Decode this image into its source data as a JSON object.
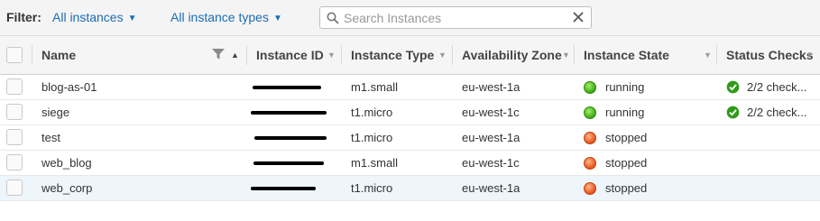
{
  "filter": {
    "label": "Filter:",
    "instances_dropdown": "All instances",
    "types_dropdown": "All instance types",
    "search_placeholder": "Search Instances"
  },
  "columns": {
    "name": "Name",
    "instance_id": "Instance ID",
    "instance_type": "Instance Type",
    "availability_zone": "Availability Zone",
    "instance_state": "Instance State",
    "status_checks": "Status Checks"
  },
  "rows": [
    {
      "name": "blog-as-01",
      "type": "m1.small",
      "zone": "eu-west-1a",
      "state": "running",
      "state_color": "#3aa80f",
      "checks": "2/2 check..."
    },
    {
      "name": "siege",
      "type": "t1.micro",
      "zone": "eu-west-1c",
      "state": "running",
      "state_color": "#3aa80f",
      "checks": "2/2 check..."
    },
    {
      "name": "test",
      "type": "t1.micro",
      "zone": "eu-west-1a",
      "state": "stopped",
      "state_color": "#e5531a",
      "checks": ""
    },
    {
      "name": "web_blog",
      "type": "m1.small",
      "zone": "eu-west-1c",
      "state": "stopped",
      "state_color": "#e5531a",
      "checks": ""
    },
    {
      "name": "web_corp",
      "type": "t1.micro",
      "zone": "eu-west-1a",
      "state": "stopped",
      "state_color": "#e5531a",
      "checks": ""
    }
  ],
  "colors": {
    "link": "#1a6db4",
    "running": "#3aa80f",
    "stopped": "#e5531a",
    "selected_row": "#eef5fb"
  },
  "icons": {
    "search": "search-icon",
    "clear": "close-icon",
    "filter": "funnel-icon",
    "running": "green-dot-icon",
    "stopped": "red-dot-icon",
    "check": "checkmark-circle-icon"
  }
}
